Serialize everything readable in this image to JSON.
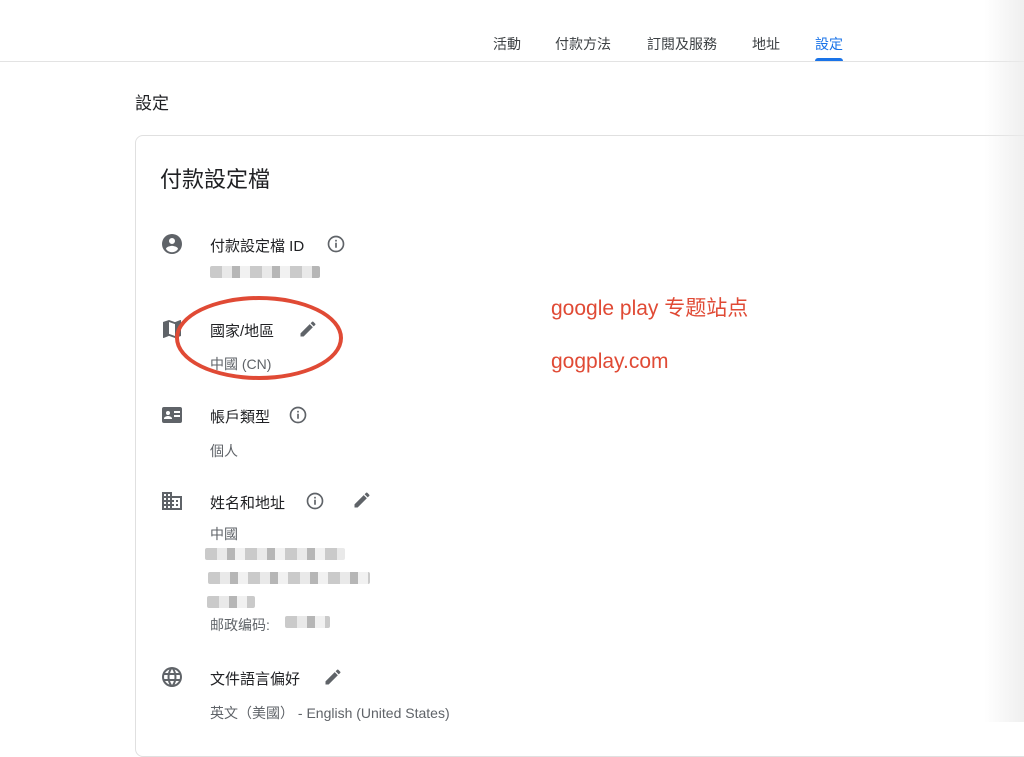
{
  "nav": {
    "tabs": [
      {
        "label": "活動",
        "active": false
      },
      {
        "label": "付款方法",
        "active": false
      },
      {
        "label": "訂閱及服務",
        "active": false
      },
      {
        "label": "地址",
        "active": false
      },
      {
        "label": "設定",
        "active": true
      }
    ],
    "accent_color": "#1a73e8"
  },
  "page": {
    "title": "設定"
  },
  "card": {
    "title": "付款設定檔",
    "rows": {
      "profile_id": {
        "label": "付款設定檔 ID",
        "icon": "account-circle-icon"
      },
      "country": {
        "label": "國家/地區",
        "value": "中國 (CN)",
        "icon": "map-icon"
      },
      "account_type": {
        "label": "帳戶類型",
        "value": "個人",
        "icon": "badge-icon"
      },
      "name_address": {
        "label": "姓名和地址",
        "value": "中國",
        "postal_label": "邮政编码:",
        "icon": "building-icon"
      },
      "language": {
        "label": "文件語言偏好",
        "value": "英文（美國） - English (United States)",
        "icon": "globe-icon"
      }
    }
  },
  "overlay": {
    "line1": "google play 专题站点",
    "line2": "gogplay.com",
    "color": "#e04a35"
  }
}
